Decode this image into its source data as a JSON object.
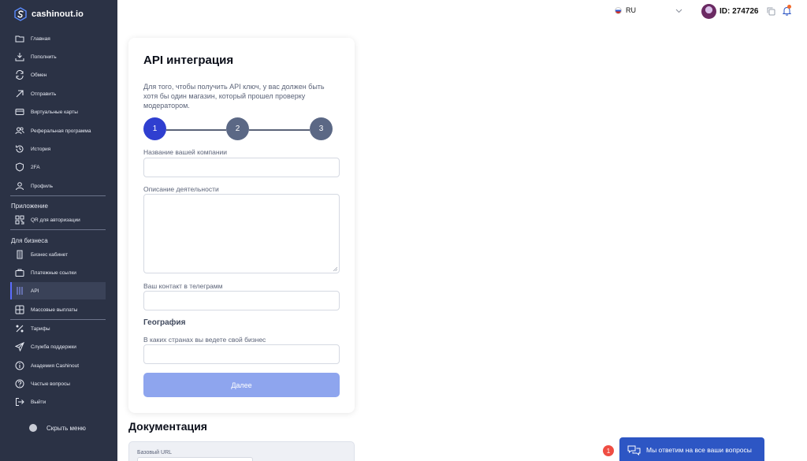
{
  "app": {
    "logo_text": "cashinout.io"
  },
  "sidebar": {
    "items": [
      {
        "label": "Главная",
        "icon": "folder-icon"
      },
      {
        "label": "Пополнить",
        "icon": "download-icon"
      },
      {
        "label": "Обмен",
        "icon": "refresh-icon"
      },
      {
        "label": "Отправить",
        "icon": "arrow-up-right-icon"
      },
      {
        "label": "Виртуальные карты",
        "icon": "card-icon"
      },
      {
        "label": "Реферальная программа",
        "icon": "users-icon"
      },
      {
        "label": "История",
        "icon": "history-icon"
      },
      {
        "label": "2FA",
        "icon": "shield-icon"
      },
      {
        "label": "Профиль",
        "icon": "user-icon"
      }
    ],
    "app_section": "Приложение",
    "app_items": [
      {
        "label": "QR для авторизации",
        "icon": "qr-icon"
      }
    ],
    "business_section": "Для бизнеса",
    "business_items": [
      {
        "label": "Бизнес кабинет",
        "icon": "building-icon"
      },
      {
        "label": "Платежные ссылки",
        "icon": "briefcase-icon"
      },
      {
        "label": "API",
        "icon": "api-icon",
        "active": true
      },
      {
        "label": "Массовые выплаты",
        "icon": "grid-icon"
      }
    ],
    "bottom_items": [
      {
        "label": "Тарифы",
        "icon": "percent-icon"
      },
      {
        "label": "Служба поддержки",
        "icon": "send-icon"
      },
      {
        "label": "Академия Cashinout",
        "icon": "info-icon"
      },
      {
        "label": "Частые вопросы",
        "icon": "question-icon"
      },
      {
        "label": "Выйти",
        "icon": "logout-icon"
      }
    ],
    "hide_menu": "Скрыть меню"
  },
  "header": {
    "language": "RU",
    "user_id": "ID: 274726"
  },
  "api_card": {
    "title": "API интеграция",
    "description": "Для того, чтобы получить API ключ, у вас должен быть хотя бы один магазин, который прошел проверку модератором.",
    "steps": [
      "1",
      "2",
      "3"
    ],
    "current_step": 1,
    "fields": {
      "company_label": "Название вашей компании",
      "company_value": "",
      "activity_label": "Описание деятельности",
      "activity_value": "",
      "telegram_label": "Ваш контакт в телеграмм",
      "telegram_value": "",
      "geo_title": "География",
      "countries_label": "В каких странах вы ведете свой бизнес",
      "countries_value": ""
    },
    "submit_label": "Далее"
  },
  "docs": {
    "title": "Документация",
    "base_url_label": "Базовый URL"
  },
  "chat": {
    "badge_count": "1",
    "label": "Мы ответим на все ваши вопросы"
  },
  "colors": {
    "sidebar_bg": "#2b3245",
    "accent": "#2f3fd0",
    "step_inactive": "#5b6885",
    "button_disabled": "#8ea5ee",
    "chat_bg": "#2d56c4",
    "badge": "#ef4d43"
  }
}
